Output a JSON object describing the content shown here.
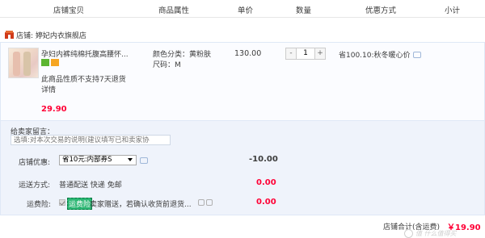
{
  "columns": {
    "shop_item": "店铺宝贝",
    "attributes": "商品属性",
    "unit_price": "单价",
    "quantity": "数量",
    "promotion": "优惠方式",
    "subtotal": "小计"
  },
  "shop": {
    "label": "店铺: 婷妃内衣旗舰店"
  },
  "item": {
    "title": "孕妇内裤纯棉托腹高腰怀...",
    "return_note": "此商品性质不支持7天退货",
    "detail_link": "详情",
    "unit_price": "29.90",
    "color_attr": "颜色分类：黄粉肤",
    "size_attr": "尺码：M",
    "price": "130.00",
    "quantity": "1",
    "minus": "-",
    "plus": "+",
    "promo_text": "省100.10:秋冬暖心价"
  },
  "order": {
    "message_label": "给卖家留言：",
    "message_placeholder": "选填:对本次交易的说明(建议填写已和卖家协",
    "coupon_label": "店铺优惠:",
    "coupon_selected": "省10元:内部券S",
    "coupon_amount": "-10.00",
    "shipping_label": "运送方式:",
    "shipping_text": "普通配送 快递 免邮",
    "shipping_amount": "0.00",
    "insurance_label": "运费险:",
    "insurance_highlight": "运费险",
    "insurance_desc": "卖家赠送，若确认收货前退货...",
    "insurance_amount": "0.00"
  },
  "total": {
    "label": "店铺合计(含运费)",
    "value": "￥19.90"
  },
  "watermark": {
    "text": "值 什么值得买"
  },
  "colors": {
    "accent_red": "#ff0036",
    "insurance_green": "#2bb673",
    "panel_bg": "#eff3fb"
  }
}
